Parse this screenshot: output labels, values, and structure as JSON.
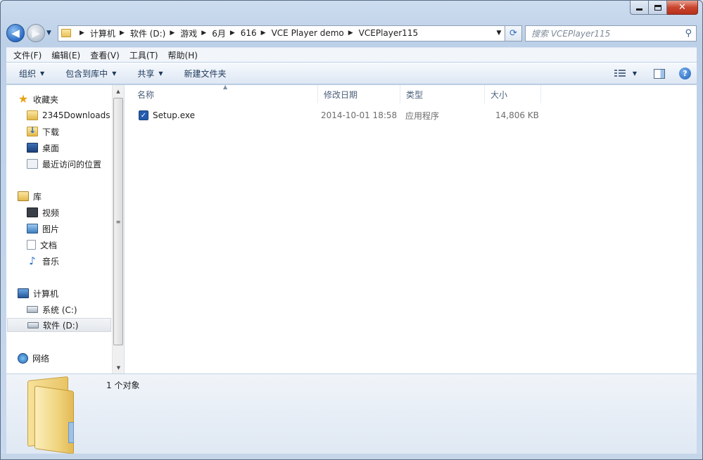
{
  "window": {
    "buttons": {
      "minimize": "",
      "maximize": "",
      "close": "✕"
    }
  },
  "nav": {
    "back_glyph": "◀",
    "forward_glyph": "▶",
    "breadcrumb": [
      "计算机",
      "软件 (D:)",
      "游戏",
      "6月",
      "616",
      "VCE Player demo",
      "VCEPlayer115"
    ],
    "search_placeholder": "搜索 VCEPlayer115"
  },
  "menubar": [
    "文件(F)",
    "编辑(E)",
    "查看(V)",
    "工具(T)",
    "帮助(H)"
  ],
  "cmdbar": {
    "organize": "组织",
    "include_library": "包含到库中",
    "share": "共享",
    "new_folder": "新建文件夹",
    "help": "?"
  },
  "navpane": {
    "favorites": "收藏夹",
    "fav_items": [
      "2345Downloads",
      "下载",
      "桌面",
      "最近访问的位置"
    ],
    "libraries": "库",
    "lib_items": [
      "视频",
      "图片",
      "文档",
      "音乐"
    ],
    "computer": "计算机",
    "computer_items": [
      "系统 (C:)",
      "软件 (D:)"
    ],
    "network": "网络"
  },
  "filelist": {
    "columns": [
      "名称",
      "修改日期",
      "类型",
      "大小"
    ],
    "files": [
      {
        "name": "Setup.exe",
        "modified": "2014-10-01 18:58",
        "type": "应用程序",
        "size": "14,806 KB"
      }
    ]
  },
  "details": {
    "count": "1 个对象"
  },
  "colors": {
    "accent": "#2a6bc4",
    "close_button": "#c9452e",
    "header_text": "#4c607a"
  }
}
